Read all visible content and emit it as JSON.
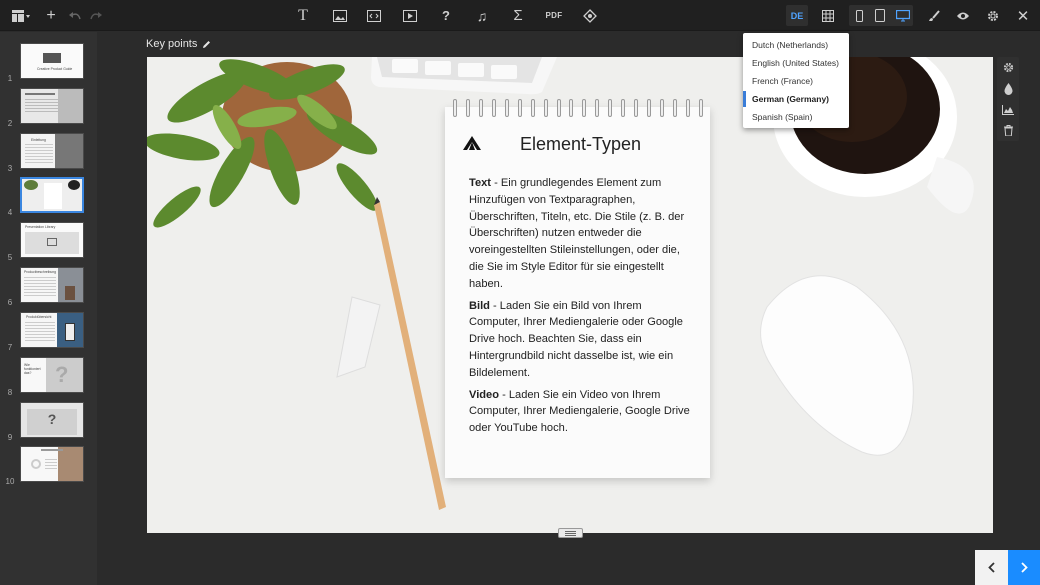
{
  "toolbar": {
    "language_code": "DE"
  },
  "language_menu": {
    "items": [
      {
        "label": "Dutch (Netherlands)",
        "selected": false
      },
      {
        "label": "English (United States)",
        "selected": false
      },
      {
        "label": "French (France)",
        "selected": false
      },
      {
        "label": "German (Germany)",
        "selected": true
      },
      {
        "label": "Spanish (Spain)",
        "selected": false
      }
    ]
  },
  "sidebar": {
    "slides": [
      {
        "number": "1",
        "caption": "Creative Product Guide"
      },
      {
        "number": "2",
        "caption": ""
      },
      {
        "number": "3",
        "caption": "Einleitung"
      },
      {
        "number": "4",
        "caption": ""
      },
      {
        "number": "5",
        "caption": "Presentation Library"
      },
      {
        "number": "6",
        "caption": "Productbeschreibung"
      },
      {
        "number": "7",
        "caption": "Produktübersicht"
      },
      {
        "number": "8",
        "caption": "Wie funktioniert das?"
      },
      {
        "number": "9",
        "caption": "?"
      },
      {
        "number": "10",
        "caption": ""
      }
    ],
    "active_index": 3
  },
  "editor": {
    "slide_label": "Key points",
    "slide": {
      "title": "Element-Typen",
      "paragraphs": [
        {
          "term": "Text",
          "text": " - Ein grundlegendes Element zum Hinzufügen von Textparagraphen, Überschriften, Titeln, etc. Die Stile (z. B. der Überschriften) nutzen entweder die voreingestellten Stileinstellungen, oder die, die Sie im Style Editor für sie eingestellt haben."
        },
        {
          "term": "Bild",
          "text": " - Laden Sie ein Bild von Ihrem Computer, Ihrer Mediengalerie oder Google Drive hoch. Beachten Sie, dass ein Hintergrundbild nicht dasselbe ist, wie ein Bildelement."
        },
        {
          "term": "Video",
          "text": " - Laden Sie ein Video von Ihrem Computer, Ihrer Mediengalerie, Google Drive oder YouTube hoch."
        }
      ]
    }
  },
  "icons": {
    "layout": "layout-icon",
    "add": "plus-icon",
    "undo": "undo-icon",
    "redo": "redo-icon",
    "text": "text-icon",
    "image": "image-icon",
    "embed": "embed-icon",
    "video": "video-icon",
    "question": "question-icon",
    "audio": "music-icon",
    "formula": "sigma-icon",
    "pdf": "pdf-icon",
    "hotspot": "hotspot-icon",
    "table": "table-icon",
    "phone": "phone-icon",
    "tablet": "tablet-icon",
    "desktop": "desktop-icon",
    "brush": "brush-icon",
    "preview": "eye-icon",
    "settings": "gear-icon",
    "close": "close-icon"
  },
  "colors": {
    "accent": "#1a8cff",
    "toolbar_bg": "#202020",
    "workspace_bg": "#2b2b2b",
    "selected_marker": "#3a7dd8"
  }
}
